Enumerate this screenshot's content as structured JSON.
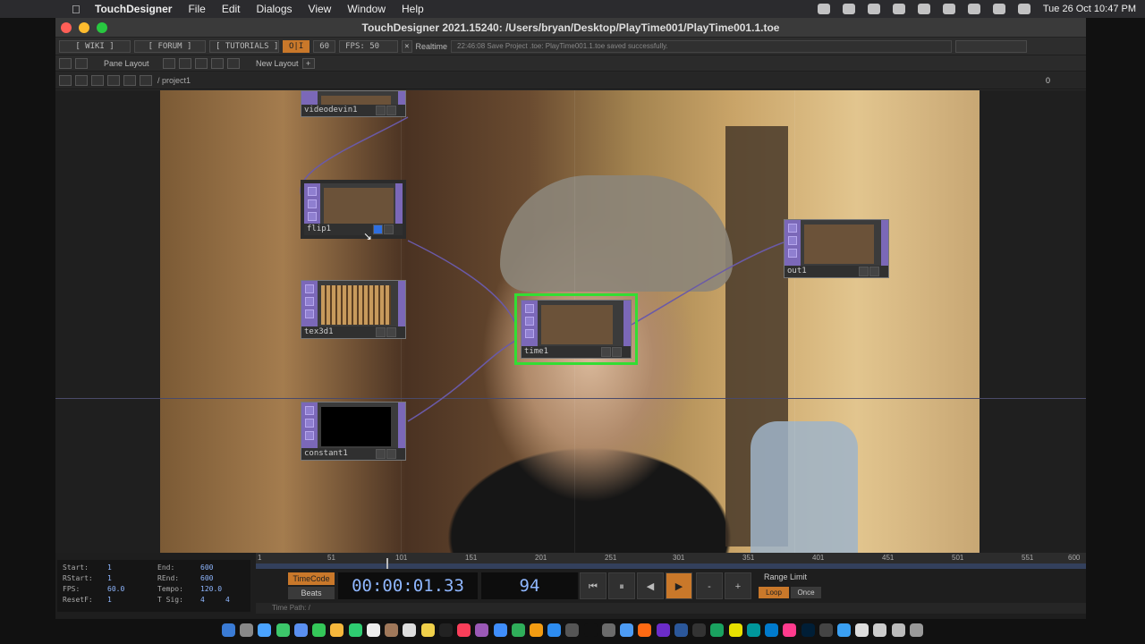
{
  "menubar": {
    "app": "TouchDesigner",
    "items": [
      "File",
      "Edit",
      "Dialogs",
      "View",
      "Window",
      "Help"
    ],
    "clock": "Tue 26 Oct  10:47 PM"
  },
  "window": {
    "title": "TouchDesigner 2021.15240: /Users/bryan/Desktop/PlayTime001/PlayTime001.1.toe"
  },
  "toolbar1": {
    "wiki": "[ WIKI ]",
    "forum": "[ FORUM ]",
    "tutorials": "[ TUTORIALS ]",
    "oi": "O|I",
    "sixty": "60",
    "fps": "FPS:  50",
    "realtime": "Realtime",
    "status": "22:46:08 Save Project .toe: PlayTime001.1.toe saved successfully."
  },
  "toolbar2": {
    "pane_layout": "Pane Layout",
    "new_layout": "New Layout",
    "plus": "+"
  },
  "pathbar": {
    "path": "/ project1",
    "zero": "0"
  },
  "nodes": [
    {
      "name": "videodevin1"
    },
    {
      "name": "flip1"
    },
    {
      "name": "tex3d1"
    },
    {
      "name": "time1"
    },
    {
      "name": "constant1"
    },
    {
      "name": "out1"
    }
  ],
  "timeline": {
    "ruler": [
      "1",
      "51",
      "101",
      "151",
      "201",
      "251",
      "301",
      "351",
      "401",
      "451",
      "501",
      "551",
      "600"
    ],
    "info": {
      "start_label": "Start:",
      "start": "1",
      "rstart_label": "RStart:",
      "rstart": "1",
      "fps_label": "FPS:",
      "fps": "60.0",
      "resetf_label": "ResetF:",
      "resetf": "1",
      "end_label": "End:",
      "end": "600",
      "rend_label": "REnd:",
      "rend": "600",
      "tempo_label": "Tempo:",
      "tempo": "120.0",
      "tsig_label": "T Sig:",
      "tsig_a": "4",
      "tsig_b": "4"
    },
    "timecode_btn": "TimeCode",
    "beats_btn": "Beats",
    "timecode": "00:00:01.33",
    "frame": "94",
    "minus": "-",
    "plus": "+",
    "range_limit": "Range Limit",
    "loop": "Loop",
    "once": "Once",
    "time_path": "Time Path: /",
    "progress": 0.157
  },
  "colors": {
    "accent": "#c9782a",
    "node_purple": "#7b68b8",
    "selected": "#33dd33",
    "timecode": "#8fb7ff"
  }
}
